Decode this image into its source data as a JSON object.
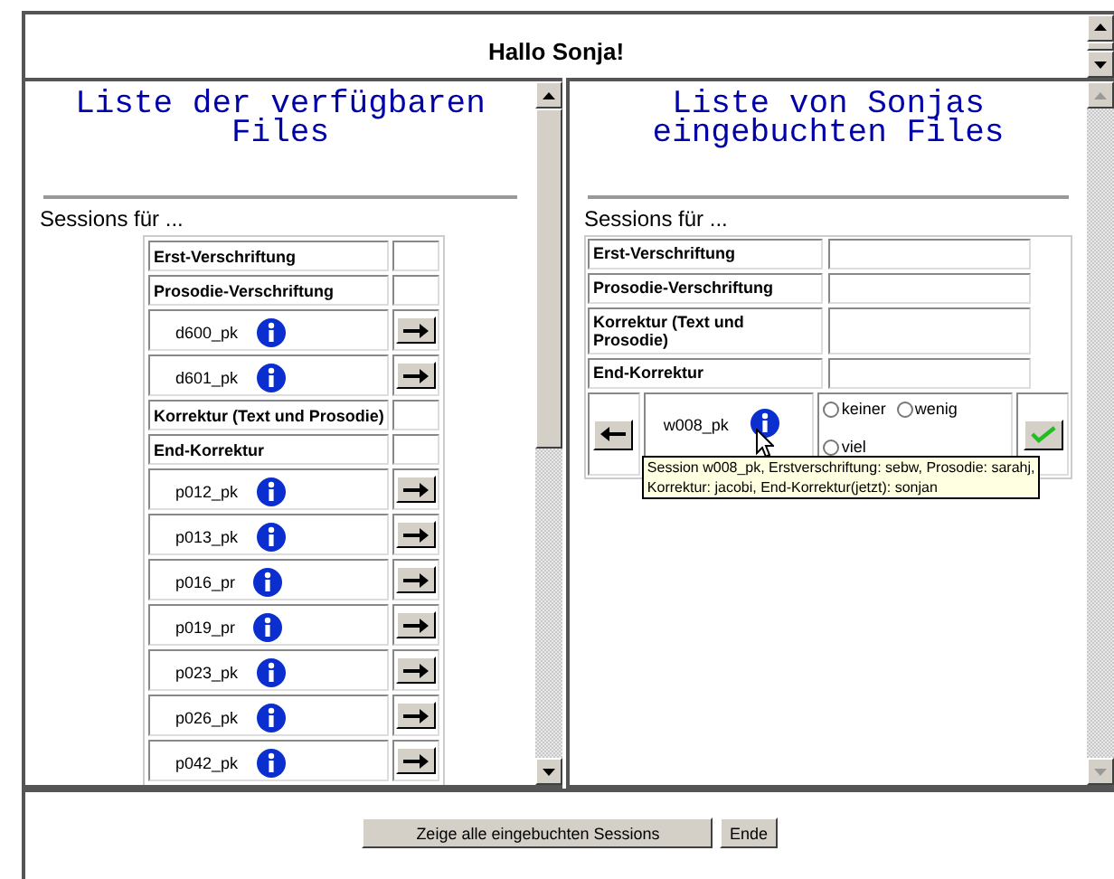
{
  "greeting": "Hallo Sonja!",
  "left": {
    "title": "Liste der verfügbaren Files",
    "sessions_label": "Sessions für ...",
    "rows": [
      {
        "kind": "header",
        "label": "Erst-Verschriftung"
      },
      {
        "kind": "header",
        "label": "Prosodie-Verschriftung"
      },
      {
        "kind": "session",
        "name": "d600_pk"
      },
      {
        "kind": "session",
        "name": "d601_pk"
      },
      {
        "kind": "header",
        "label": "Korrektur (Text und Prosodie)"
      },
      {
        "kind": "header",
        "label": "End-Korrektur"
      },
      {
        "kind": "session",
        "name": "p012_pk"
      },
      {
        "kind": "session",
        "name": "p013_pk"
      },
      {
        "kind": "session",
        "name": "p016_pr"
      },
      {
        "kind": "session",
        "name": "p019_pr"
      },
      {
        "kind": "session",
        "name": "p023_pk"
      },
      {
        "kind": "session",
        "name": "p026_pk"
      },
      {
        "kind": "session",
        "name": "p042_pk"
      }
    ]
  },
  "right": {
    "title": "Liste von Sonjas eingebuchten Files",
    "sessions_label": "Sessions für ...",
    "rows": [
      {
        "kind": "header",
        "label": "Erst-Verschriftung"
      },
      {
        "kind": "header",
        "label": "Prosodie-Verschriftung"
      },
      {
        "kind": "header",
        "label": "Korrektur (Text und Prosodie)"
      },
      {
        "kind": "header",
        "label": "End-Korrektur"
      },
      {
        "kind": "booked",
        "name": "w008_pk",
        "options": [
          {
            "label": "keiner",
            "selected": false
          },
          {
            "label": "wenig",
            "selected": false
          },
          {
            "label": "viel",
            "selected": false
          }
        ]
      }
    ],
    "tooltip": "Session w008_pk, Erstverschriftung: sebw, Prosodie: sarahj,\nKorrektur: jacobi, End-Korrektur(jetzt): sonjan"
  },
  "buttons": [
    "Zeige alle eingebuchten Sessions",
    "Ende"
  ]
}
